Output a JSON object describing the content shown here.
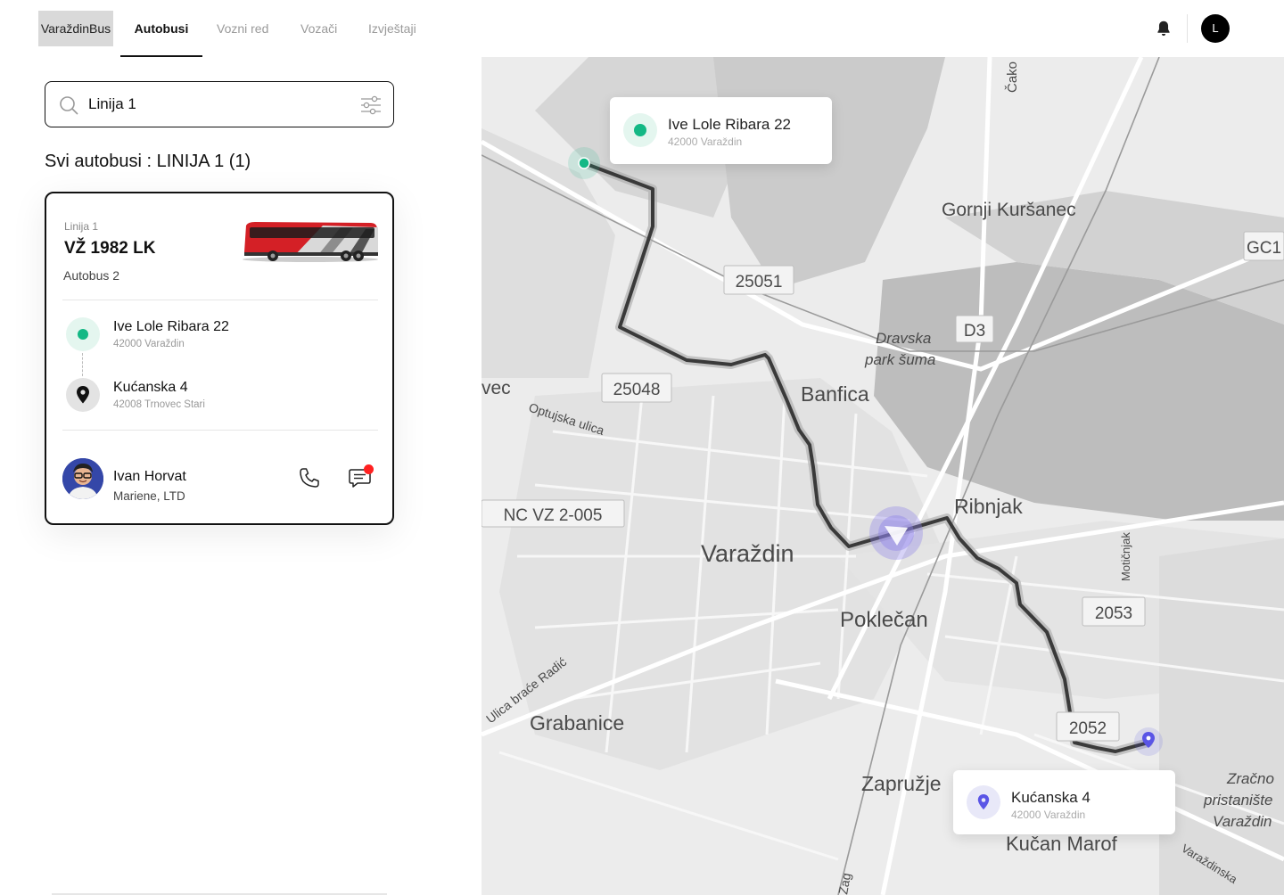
{
  "nav": {
    "brand": "VaraždinBus",
    "tabs": [
      {
        "label": "Autobusi",
        "active": true
      },
      {
        "label": "Vozni red",
        "active": false
      },
      {
        "label": "Vozači",
        "active": false
      },
      {
        "label": "Izvještaji",
        "active": false
      }
    ],
    "user_initial": "L"
  },
  "search": {
    "value": "Linija 1"
  },
  "list": {
    "title": "Svi autobusi : LINIJA 1 (1)"
  },
  "bus_card": {
    "line": "Linija 1",
    "plate": "VŽ 1982 LK",
    "bus_name": "Autobus 2",
    "stops": [
      {
        "name": "Ive Lole Ribara 22",
        "address": "42000 Varaždin"
      },
      {
        "name": "Kućanska 4",
        "address": "42008 Trnovec Stari"
      }
    ],
    "driver": {
      "name": "Ivan Horvat",
      "company": "Mariene, LTD"
    }
  },
  "map": {
    "labels": {
      "gornji": "Gornji Kuršanec",
      "r25051": "25051",
      "d3": "D3",
      "dravska1": "Dravska",
      "dravska2": "park šuma",
      "r25048": "25048",
      "banfica": "Banfica",
      "optujska": "Optujska ulica",
      "ncvz": "NC VZ 2-005",
      "ribnjak": "Ribnjak",
      "varazdin": "Varaždin",
      "poklecan": "Poklečan",
      "r2053": "2053",
      "ulica": "Ulica braće Radić",
      "grabanice": "Grabanice",
      "r2052": "2052",
      "zapruzje": "Zapružje",
      "kucan": "Kučan Marof",
      "zracno1": "Zračno",
      "zracno2": "pristanište",
      "zracno3": "Varaždin",
      "gc": "GC1",
      "vec": "vec",
      "motic": "Motičnjak",
      "cako": "Čako",
      "zag": "Zag",
      "varazdinska": "Varaždinska"
    },
    "popup_start": {
      "name": "Ive Lole Ribara 22",
      "address": "42000 Varaždin"
    },
    "popup_end": {
      "name": "Kućanska 4",
      "address": "42000 Varaždin"
    },
    "colors": {
      "start": "#14b885",
      "end": "#5a55e6",
      "route": "#3a3a3a"
    }
  }
}
